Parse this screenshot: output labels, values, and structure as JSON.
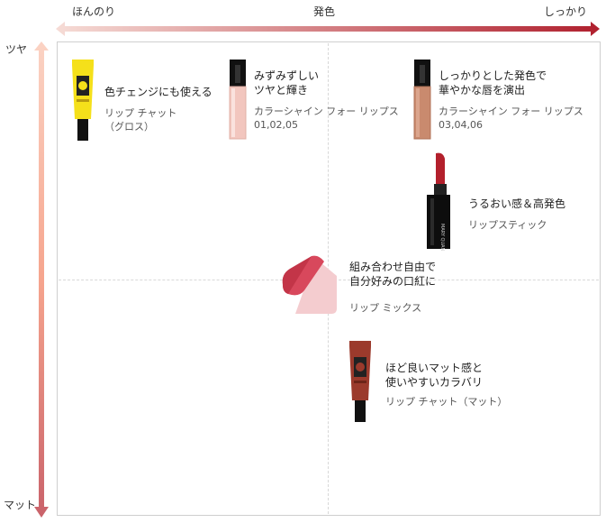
{
  "axes": {
    "x_left": "ほんのり",
    "x_center": "発色",
    "x_right": "しっかり",
    "y_top": "ツヤ",
    "y_bottom": "マット"
  },
  "colors": {
    "x_arrow_start": "#f6dcd6",
    "x_arrow_end": "#b0202e",
    "y_arrow_top": "#f6a58e",
    "y_arrow_bottom": "#c9626a",
    "frame": "#cfcfcf"
  },
  "products": [
    {
      "title_1": "色チェンジにも使える",
      "title_2": "",
      "sub_1": "リップ チャット",
      "sub_2": "（グロス）",
      "image": "yellow-gloss-tube",
      "color": "#f5e01a"
    },
    {
      "title_1": "みずみずしい",
      "title_2": "ツヤと輝き",
      "sub_1": "カラーシャイン フォー リップス",
      "sub_2": "01,02,05",
      "image": "pink-liquid-lip",
      "color": "#f2c6be"
    },
    {
      "title_1": "しっかりとした発色で",
      "title_2": "華やかな唇を演出",
      "sub_1": "カラーシャイン フォー リップス",
      "sub_2": "03,04,06",
      "image": "brown-liquid-lip",
      "color": "#c98a6e"
    },
    {
      "title_1": "うるおい感＆高発色",
      "title_2": "",
      "sub_1": "リップスティック",
      "sub_2": "",
      "image": "red-lipstick",
      "color": "#b3202c"
    },
    {
      "title_1": "組み合わせ自由で",
      "title_2": "自分好みの口紅に",
      "sub_1": "リップ ミックス",
      "sub_2": "",
      "image": "lip-mix-swatches",
      "color": "#d8485c"
    },
    {
      "title_1": "ほど良いマット感と",
      "title_2": "使いやすいカラバリ",
      "sub_1": "リップ チャット（マット）",
      "sub_2": "",
      "image": "matte-red-tube",
      "color": "#9b3a2c"
    }
  ]
}
